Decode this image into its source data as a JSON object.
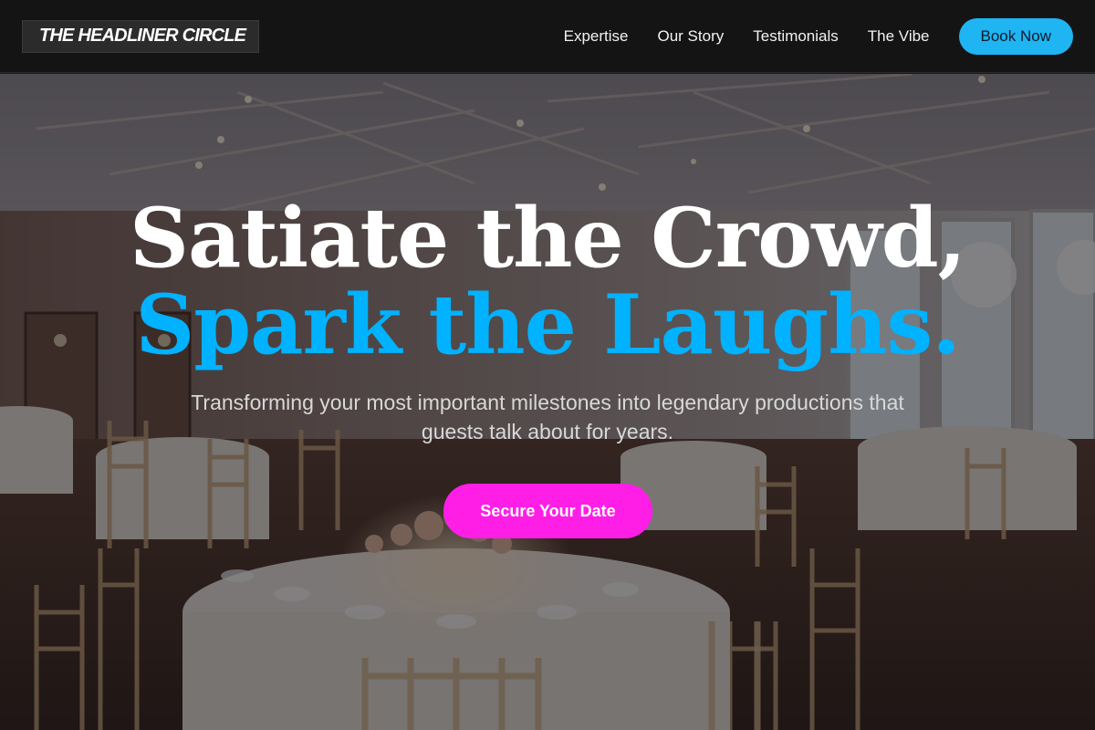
{
  "header": {
    "logo_text": "THE HEADLINER CIRCLE",
    "nav": {
      "expertise": "Expertise",
      "our_story": "Our Story",
      "testimonials": "Testimonials",
      "the_vibe": "The Vibe"
    },
    "book_label": "Book Now"
  },
  "hero": {
    "headline_line1": "Satiate the Crowd,",
    "headline_line2": "Spark the Laughs.",
    "subtext": "Transforming your most important milestones into legendary productions that guests talk about for years.",
    "cta_label": "Secure Your Date",
    "background_alt": "banquet-hall-photo"
  },
  "colors": {
    "header_bg": "#141414",
    "accent_blue": "#00b2ff",
    "book_button": "#1fb4f2",
    "cta_magenta": "#ff1ee6",
    "headline_white": "#ffffff"
  }
}
